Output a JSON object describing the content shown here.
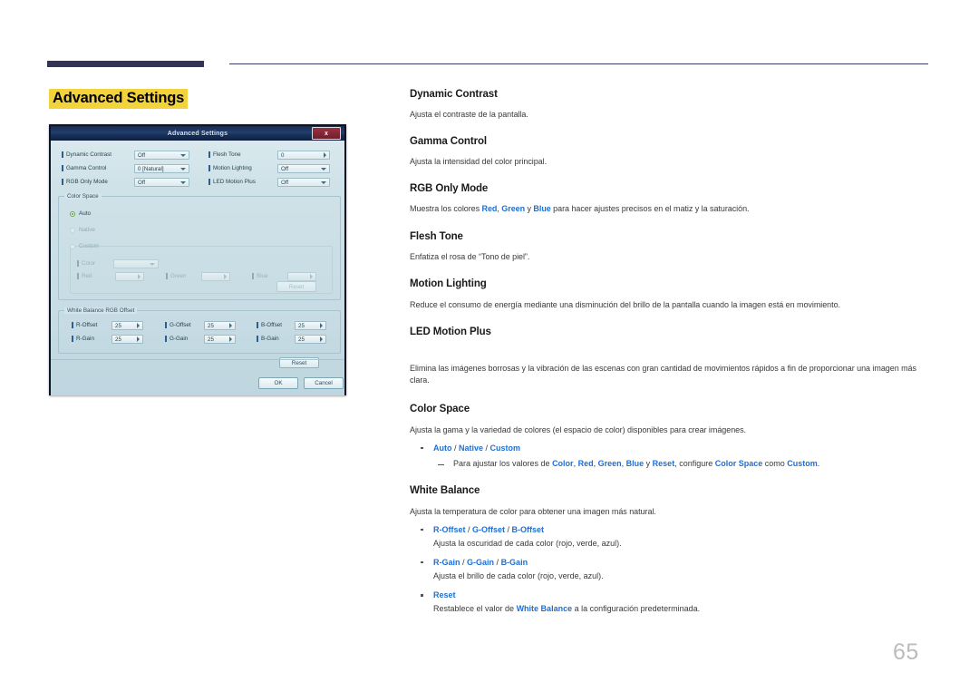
{
  "page": {
    "number": "65",
    "title": "Advanced Settings"
  },
  "osd": {
    "title": "Advanced Settings",
    "close_label": "x",
    "fields_left": [
      {
        "label": "Dynamic Contrast",
        "value": "Off",
        "control": "dropdown"
      },
      {
        "label": "Gamma Control",
        "value": "0 [Natural]",
        "control": "dropdown"
      },
      {
        "label": "RGB Only Mode",
        "value": "Off",
        "control": "dropdown"
      }
    ],
    "fields_right": [
      {
        "label": "Flesh Tone",
        "value": "0",
        "control": "spinner"
      },
      {
        "label": "Motion Lighting",
        "value": "Off",
        "control": "dropdown"
      },
      {
        "label": "LED Motion Plus",
        "value": "Off",
        "control": "dropdown"
      }
    ],
    "color_space": {
      "group_title": "Color Space",
      "options": [
        {
          "label": "Auto",
          "selected": true
        },
        {
          "label": "Native",
          "selected": false
        },
        {
          "label": "Custom",
          "selected": false
        }
      ],
      "custom": {
        "color_label": "Color",
        "color_value": "",
        "red_label": "Red",
        "red_value": "",
        "green_label": "Green",
        "green_value": "",
        "blue_label": "Blue",
        "blue_value": "",
        "reset_label": "Reset"
      }
    },
    "white_balance": {
      "group_title": "White Balance RGB Offset",
      "items": [
        {
          "label": "R-Offset",
          "value": "25"
        },
        {
          "label": "G-Offset",
          "value": "25"
        },
        {
          "label": "B-Offset",
          "value": "25"
        },
        {
          "label": "R-Gain",
          "value": "25"
        },
        {
          "label": "G-Gain",
          "value": "25"
        },
        {
          "label": "B-Gain",
          "value": "25"
        }
      ],
      "reset_label": "Reset"
    },
    "ok_label": "OK",
    "cancel_label": "Cancel"
  },
  "sections": {
    "dynamic_contrast": {
      "head": "Dynamic Contrast",
      "body": "Ajusta el contraste de la pantalla."
    },
    "gamma_control": {
      "head": "Gamma Control",
      "body": "Ajusta la intensidad del color principal."
    },
    "rgb_only_mode": {
      "head": "RGB Only Mode",
      "body_pre": "Muestra los colores ",
      "red": "Red",
      "sep1": ", ",
      "green": "Green",
      "sep2": " y ",
      "blue": "Blue",
      "body_post": " para hacer ajustes precisos en el matiz y la saturación."
    },
    "flesh_tone": {
      "head": "Flesh Tone",
      "body": "Enfatiza el rosa de “Tono de piel”."
    },
    "motion_lighting": {
      "head": "Motion Lighting",
      "body": "Reduce el consumo de energía mediante una disminución del brillo de la pantalla cuando la imagen está en movimiento."
    },
    "led_motion_plus": {
      "head": "LED Motion Plus",
      "body": "Elimina las imágenes borrosas y la vibración de las escenas con gran cantidad de movimientos rápidos a fin de proporcionar una imagen más clara."
    },
    "color_space": {
      "head": "Color Space",
      "body": "Ajusta la gama y la variedad de colores (el espacio de color) disponibles para crear imágenes.",
      "bullet_auto": "Auto",
      "bullet_sep1": " / ",
      "bullet_native": "Native",
      "bullet_sep2": " / ",
      "bullet_custom": "Custom",
      "sub_pre": "Para ajustar los valores de ",
      "sub_color": "Color",
      "sub_s1": ", ",
      "sub_red": "Red",
      "sub_s2": ", ",
      "sub_green": "Green",
      "sub_s3": ", ",
      "sub_blue": "Blue",
      "sub_s4": " y ",
      "sub_reset": "Reset",
      "sub_mid": ", configure ",
      "sub_colorspace": "Color Space",
      "sub_como": " como ",
      "sub_custom": "Custom",
      "sub_end": "."
    },
    "white_balance": {
      "head": "White Balance",
      "body": "Ajusta la temperatura de color para obtener una imagen más natural.",
      "b1_r": "R-Offset",
      "b1_s1": " / ",
      "b1_g": "G-Offset",
      "b1_s2": " / ",
      "b1_b": "B-Offset",
      "b1_sub": "Ajusta la oscuridad de cada color (rojo, verde, azul).",
      "b2_r": "R-Gain",
      "b2_s1": " / ",
      "b2_g": "G-Gain",
      "b2_s2": " / ",
      "b2_b": "B-Gain",
      "b2_sub": "Ajusta el brillo de cada color (rojo, verde, azul).",
      "b3_reset": "Reset",
      "b3_sub_pre": "Restablece el valor de ",
      "b3_sub_wb": "White Balance",
      "b3_sub_post": " a la configuración predeterminada."
    }
  },
  "colors": {
    "accent_blue": "#1f6fd4",
    "highlight_yellow": "#f2d33c",
    "rule_navy": "#323356"
  }
}
